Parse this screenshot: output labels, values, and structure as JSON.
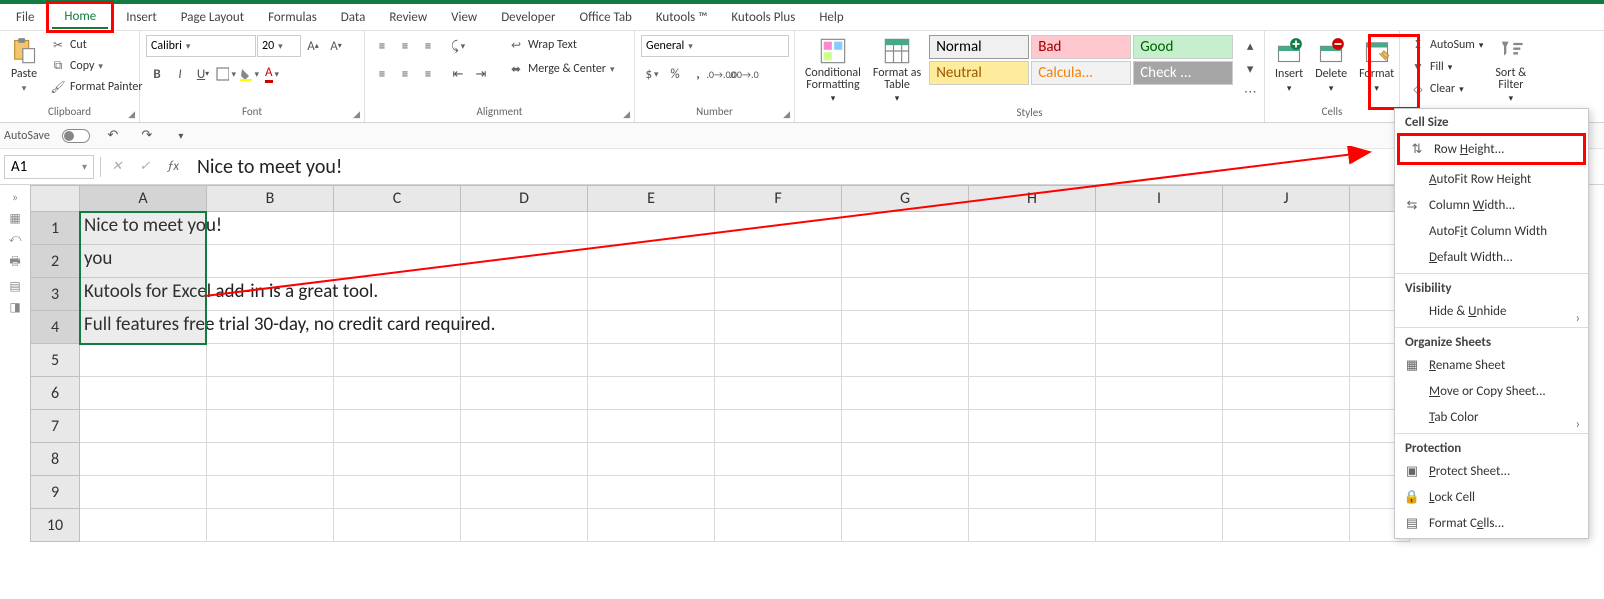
{
  "tabs": {
    "file": "File",
    "home": "Home",
    "insert": "Insert",
    "page_layout": "Page Layout",
    "formulas": "Formulas",
    "data": "Data",
    "review": "Review",
    "view": "View",
    "developer": "Developer",
    "office_tab": "Office Tab",
    "kutools": "Kutools ™",
    "kutools_plus": "Kutools Plus",
    "help": "Help"
  },
  "clipboard": {
    "title": "Clipboard",
    "paste": "Paste",
    "cut": "Cut",
    "copy": "Copy",
    "format_painter": "Format Painter"
  },
  "font": {
    "title": "Font",
    "name": "Calibri",
    "size": "20"
  },
  "alignment": {
    "title": "Alignment",
    "wrap": "Wrap Text",
    "merge": "Merge & Center"
  },
  "number": {
    "title": "Number",
    "format": "General"
  },
  "styles": {
    "title": "Styles",
    "conditional": "Conditional\nFormatting",
    "format_as": "Format as\nTable",
    "normal": "Normal",
    "bad": "Bad",
    "good": "Good",
    "neutral": "Neutral",
    "calc": "Calcula...",
    "check": "Check ..."
  },
  "cells": {
    "title": "Cells",
    "insert": "Insert",
    "delete": "Delete",
    "format": "Format"
  },
  "editing": {
    "autosum": "AutoSum",
    "fill": "Fill",
    "clear": "Clear",
    "sort": "Sort &\nFilter"
  },
  "autosave": {
    "label": "AutoSave"
  },
  "namebox": "A1",
  "formula": "Nice to meet you!",
  "cols": [
    "A",
    "B",
    "C",
    "D",
    "E",
    "F",
    "G",
    "H",
    "I",
    "J"
  ],
  "rows": {
    "1": "Nice to meet you!",
    "2": "you",
    "3": "Kutools for Excel add-in is a great tool.",
    "4": "Full features free trial 30-day, no credit card required."
  },
  "menu": {
    "cell_size": "Cell Size",
    "row_height": "Row Height...",
    "autofit_row": "AutoFit Row Height",
    "col_width": "Column Width...",
    "autofit_col": "AutoFit Column Width",
    "default_width": "Default Width...",
    "visibility": "Visibility",
    "hide_unhide": "Hide & Unhide",
    "organize": "Organize Sheets",
    "rename": "Rename Sheet",
    "move_copy": "Move or Copy Sheet...",
    "tab_color": "Tab Color",
    "protection": "Protection",
    "protect": "Protect Sheet...",
    "lock": "Lock Cell",
    "format_cells": "Format Cells..."
  }
}
